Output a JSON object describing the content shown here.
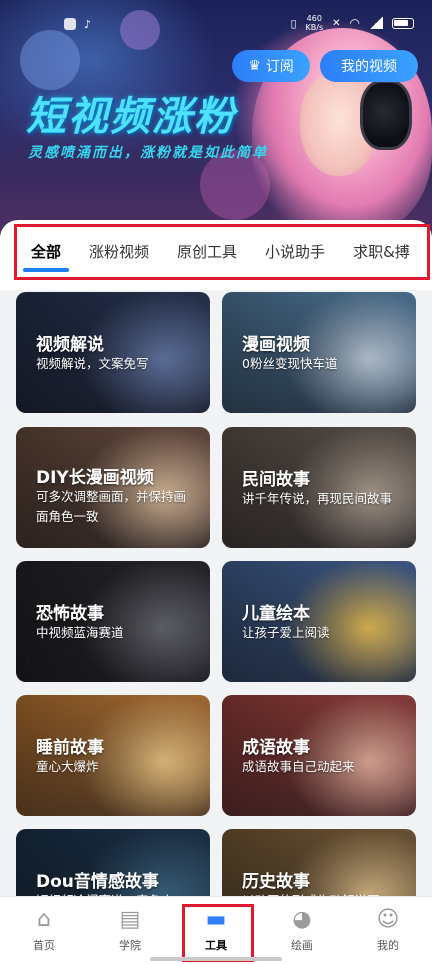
{
  "status_bar": {
    "net_speed": "460",
    "net_unit": "KB/s"
  },
  "banner": {
    "subscribe_label": "订阅",
    "my_video_label": "我的视频",
    "title": "短视频涨粉",
    "subtitle": "灵感喷涌而出，涨粉就是如此简单"
  },
  "tabs": [
    {
      "label": "全部",
      "active": true
    },
    {
      "label": "涨粉视频",
      "active": false
    },
    {
      "label": "原创工具",
      "active": false
    },
    {
      "label": "小说助手",
      "active": false
    },
    {
      "label": "求职&搏",
      "active": false
    }
  ],
  "cards": [
    {
      "title": "视频解说",
      "desc": "视频解说，文案免写",
      "bg": "#2b3a5c",
      "accent": "#6a7fb0"
    },
    {
      "title": "漫画视频",
      "desc": "0粉丝变现快车道",
      "bg": "#5e8fb8",
      "accent": "#c9d8e8"
    },
    {
      "title": "DIY长漫画视频",
      "desc": "可多次调整画面，并保持画面角色一致",
      "bg": "#7a5a4a",
      "accent": "#e8c7a5"
    },
    {
      "title": "民间故事",
      "desc": "讲千年传说，再现民间故事",
      "bg": "#6e6258",
      "accent": "#b7a99a"
    },
    {
      "title": "恐怖故事",
      "desc": "中视频蓝海赛道",
      "bg": "#2a2a2e",
      "accent": "#6c6c74"
    },
    {
      "title": "儿童绘本",
      "desc": "让孩子爱上阅读",
      "bg": "#4c6fa8",
      "accent": "#f3c75a"
    },
    {
      "title": "睡前故事",
      "desc": "童心大爆炸",
      "bg": "#d98a3c",
      "accent": "#f7d08a"
    },
    {
      "title": "成语故事",
      "desc": "成语故事自己动起来",
      "bg": "#b24a46",
      "accent": "#f0b8a4"
    },
    {
      "title": "Dou音情感故事",
      "desc": "短视频冷门赛道，竞争小",
      "bg": "#1f3a55",
      "accent": "#3f6b8a"
    },
    {
      "title": "历史故事",
      "desc": "以动画的形式生动解说历",
      "bg": "#8a6a3e",
      "accent": "#e7c58f"
    }
  ],
  "bottom_nav": [
    {
      "label": "首页",
      "icon": "home-icon",
      "active": false
    },
    {
      "label": "学院",
      "icon": "book-icon",
      "active": false
    },
    {
      "label": "工具",
      "icon": "toolbox-icon",
      "active": true
    },
    {
      "label": "绘画",
      "icon": "palette-icon",
      "active": false
    },
    {
      "label": "我的",
      "icon": "user-icon",
      "active": false
    }
  ],
  "colors": {
    "accent": "#2d7ef7",
    "highlight_box": "#e0192d",
    "banner_title": "#4de0ff"
  }
}
